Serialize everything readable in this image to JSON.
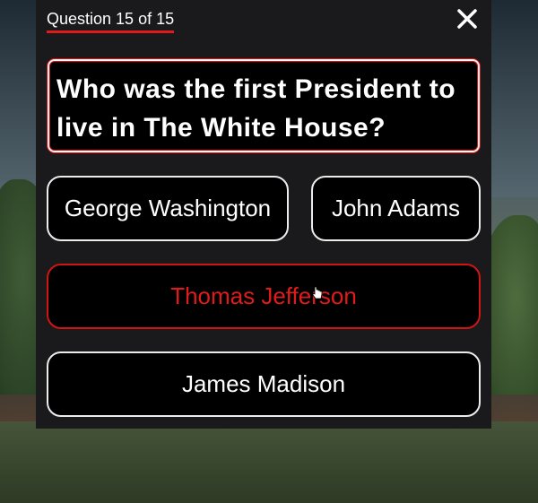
{
  "quiz": {
    "progress_label": "Question 15 of 15",
    "question": "Who was the first President to live in The White House?",
    "answers": [
      {
        "label": "George Washington",
        "selected": false
      },
      {
        "label": "John Adams",
        "selected": false
      },
      {
        "label": "Thomas Jefferson",
        "selected": true
      },
      {
        "label": "James Madison",
        "selected": false
      }
    ],
    "close_icon": "close-icon"
  },
  "colors": {
    "accent": "#e11b1b",
    "panel_bg": "#1a1a1c",
    "button_bg": "#000000",
    "text": "#ffffff"
  }
}
